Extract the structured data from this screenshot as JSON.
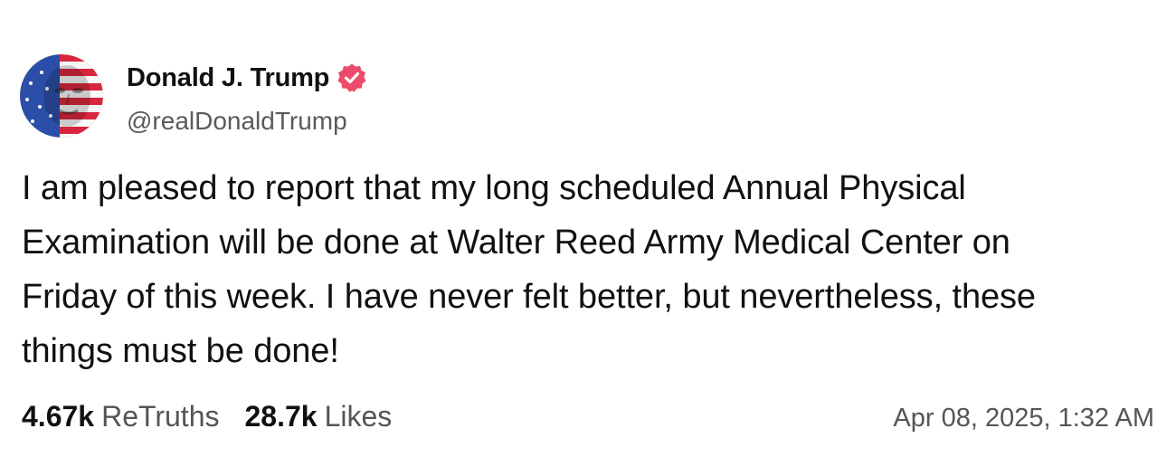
{
  "author": {
    "name": "Donald J. Trump",
    "handle": "@realDonaldTrump",
    "verified": true,
    "avatar_icon": "flag-portrait-avatar-icon",
    "verified_icon": "verified-badge-icon"
  },
  "post": {
    "text": "I am pleased to report that my long scheduled Annual Physical\nExamination will be done at Walter Reed Army Medical Center on\nFriday of this week. I have never felt better, but nevertheless, these\nthings must be done!",
    "timestamp": "Apr 08, 2025, 1:32 AM"
  },
  "stats": {
    "retruths_count": "4.67k",
    "retruths_label": "ReTruths",
    "likes_count": "28.7k",
    "likes_label": "Likes"
  },
  "colors": {
    "verified_badge": "#ec4b6b",
    "text_primary": "#111111",
    "text_secondary": "#555555"
  }
}
